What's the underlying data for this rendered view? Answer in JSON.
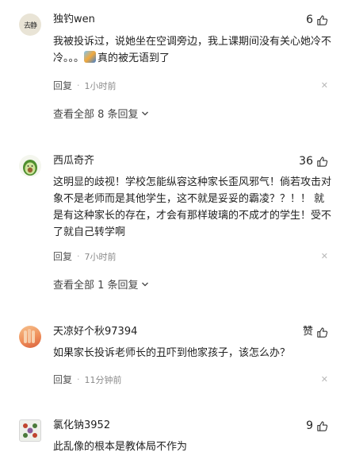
{
  "comments": [
    {
      "username": "独钓wen",
      "likes": "6",
      "content_pre": "我被投诉过，说她坐在空调旁边，我上课期间没有关心她冷不冷。。。",
      "content_post": "真的被无语到了",
      "reply_label": "回复",
      "time": "1小时前",
      "view_all": "查看全部 8 条回复",
      "avatar_text": "去静"
    },
    {
      "username": "西瓜奇齐",
      "likes": "36",
      "content": "这明显的歧视！学校怎能纵容这种家长歪风邪气！倘若攻击对象不是老师而是其他学生，这不就是妥妥的霸凌？？！！ 就是有这种家长的存在，才会有那样玻璃的不成才的学生！受不了就自己转学啊",
      "reply_label": "回复",
      "time": "7小时前",
      "view_all": "查看全部 1 条回复"
    },
    {
      "username": "天凉好个秋97394",
      "likes": "赞",
      "content": "如果家长投诉老师长的丑吓到他家孩子，该怎么办？",
      "reply_label": "回复",
      "time": "11分钟前"
    },
    {
      "username": "氯化钠3952",
      "likes": "9",
      "content": "此乱像的根本是教体局不作为"
    }
  ],
  "icons": {
    "like": "thumbs-up-icon",
    "close": "close-icon",
    "chevron": "chevron-down-icon"
  }
}
